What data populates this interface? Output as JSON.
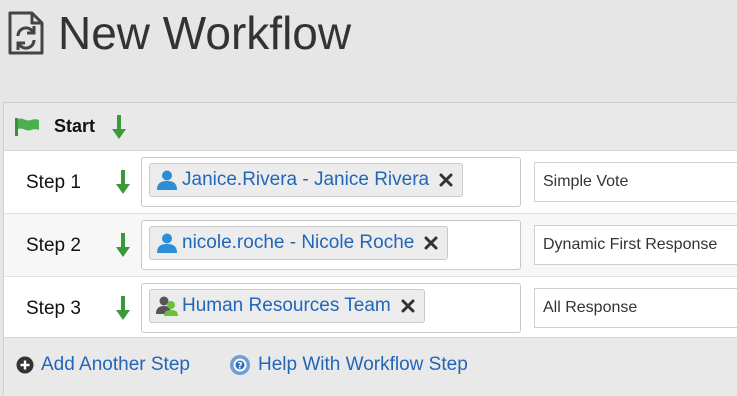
{
  "header": {
    "title": "New Workflow",
    "icon": "document-sync-icon"
  },
  "workflow": {
    "start_label": "Start",
    "steps": [
      {
        "label": "Step 1",
        "assignee": "Janice.Rivera - Janice Rivera",
        "assignee_type": "user-icon",
        "response_type": "Simple Vote"
      },
      {
        "label": "Step 2",
        "assignee": "nicole.roche - Nicole Roche",
        "assignee_type": "user-icon",
        "response_type": "Dynamic First Response"
      },
      {
        "label": "Step 3",
        "assignee": "Human Resources Team",
        "assignee_type": "group-icon",
        "response_type": "All Response"
      }
    ]
  },
  "footer": {
    "add_step_label": "Add Another Step",
    "help_label": "Help With Workflow Step"
  },
  "colors": {
    "link": "#2266b8",
    "user_icon": "#2c8fd6",
    "arrow": "#3a9a3a",
    "flag": "#4caf50"
  }
}
